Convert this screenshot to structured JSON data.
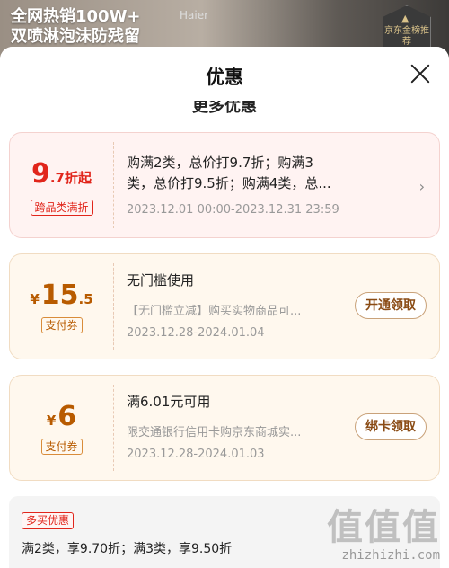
{
  "background": {
    "line1": "全网热销100W+",
    "line2": "双喷淋泡沫防残留",
    "brand": "Haier",
    "badge": "京东金榜推荐"
  },
  "sheet": {
    "title": "优惠",
    "section_title": "更多优惠"
  },
  "coupons": [
    {
      "amount_main": "9",
      "amount_suffix": ".7折起",
      "tag": "跨品类满折",
      "title_line1": "购满2类，总价打9.7折；购满3",
      "title_line2": "类，总价打9.5折；购满4类，总...",
      "date": "2023.12.01 00:00-2023.12.31 23:59"
    },
    {
      "currency": "¥",
      "amount_main": "15",
      "amount_suffix": ".5",
      "tag": "支付券",
      "title": "无门槛使用",
      "desc": "【无门槛立减】购买实物商品可...",
      "date": "2023.12.28-2024.01.04",
      "button": "开通领取"
    },
    {
      "currency": "¥",
      "amount_main": "6",
      "tag": "支付券",
      "title": "满6.01元可用",
      "desc": "限交通银行信用卡购京东商城实...",
      "date": "2023.12.28-2024.01.03",
      "button": "绑卡领取"
    }
  ],
  "multi_buy": {
    "tag": "多买优惠",
    "text": "满2类，享9.70折；满3类，享9.50折"
  },
  "watermark": {
    "logo": "值值值",
    "url": "zhizhizhi.com"
  }
}
